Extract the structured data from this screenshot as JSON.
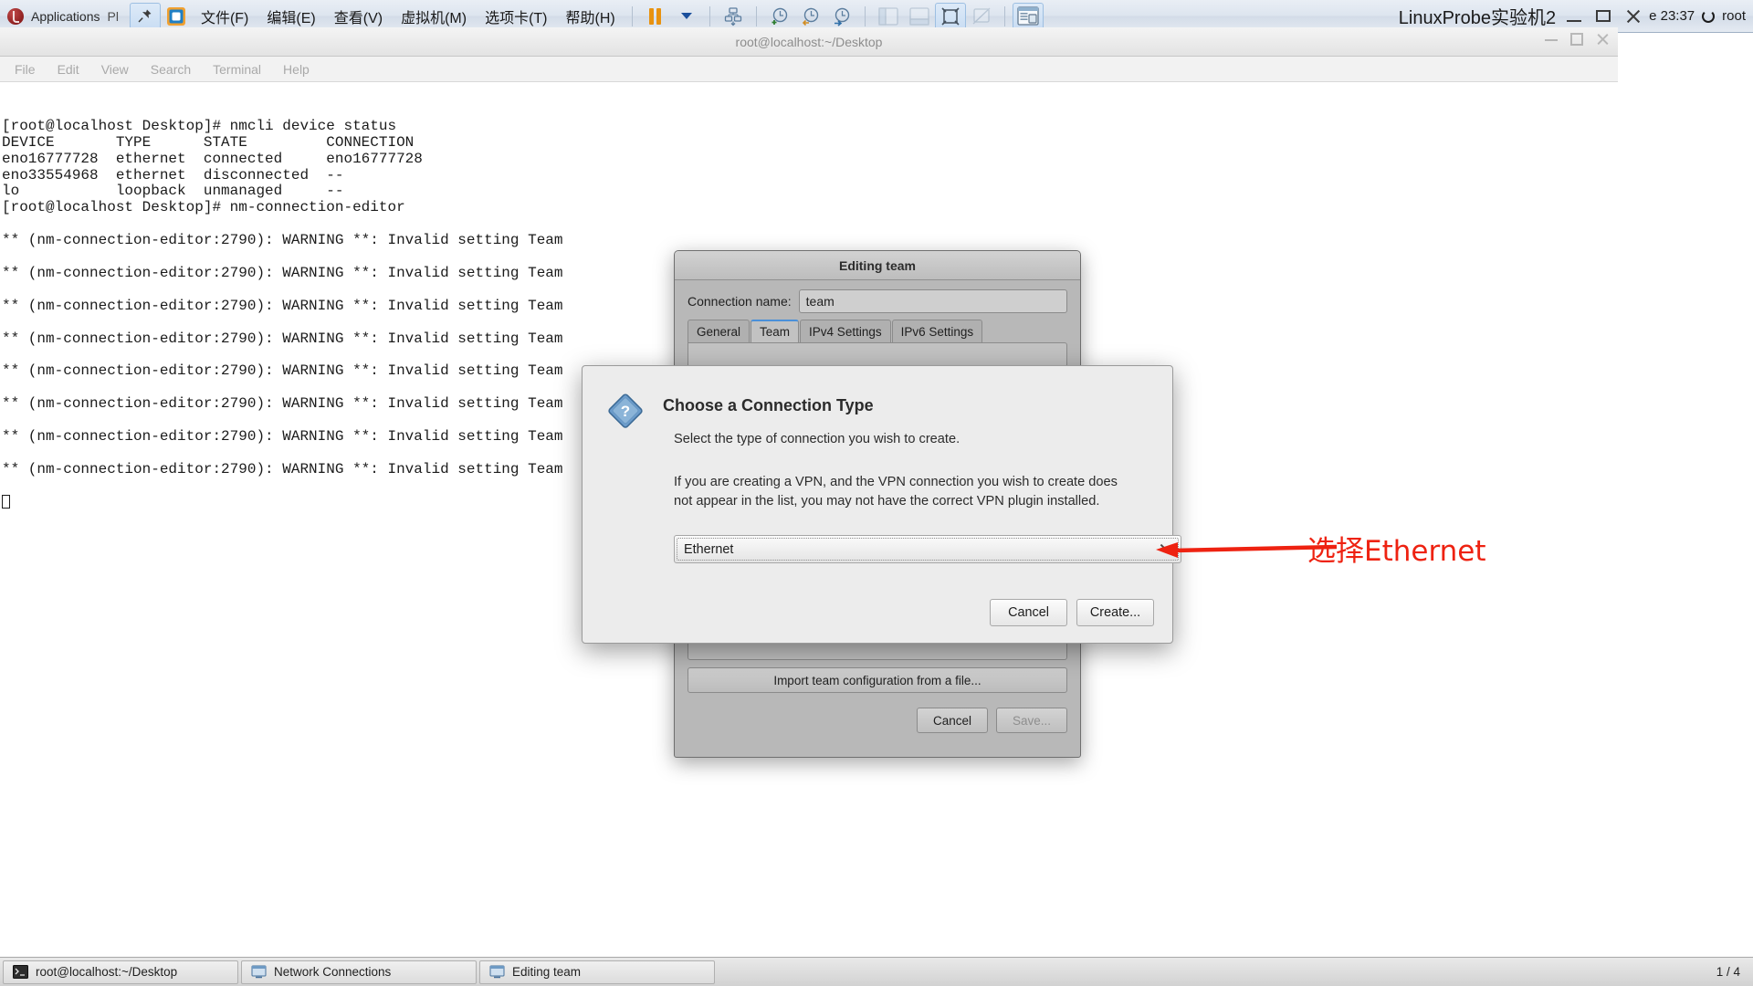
{
  "vmware": {
    "gnome_applications": "Applications",
    "gnome_places": "Pl",
    "menus": [
      "文件(F)",
      "编辑(E)",
      "查看(V)",
      "虚拟机(M)",
      "选项卡(T)",
      "帮助(H)"
    ],
    "vm_title": "LinuxProbe实验机2",
    "clock": "e 23:37",
    "user": "root",
    "icons": {
      "pin": "pin-icon",
      "vmware_logo": "vmware-logo-icon",
      "pause": "pause-icon",
      "dropdown": "caret-down-icon",
      "snapshot": "snapshot-manager-icon",
      "take_snapshot": "take-snapshot-icon",
      "revert_snapshot": "revert-snapshot-icon",
      "manage_snapshot": "manage-snapshot-icon",
      "show_library": "show-library-icon",
      "show_thumbnails": "show-thumbnail-bar-icon",
      "fullscreen": "enter-fullscreen-icon",
      "unity": "unity-mode-icon",
      "console_view": "console-view-icon",
      "minimize": "minimize-icon",
      "maximize": "maximize-icon",
      "close": "close-icon",
      "power": "power-icon"
    }
  },
  "terminal": {
    "title": "root@localhost:~/Desktop",
    "menus": [
      "File",
      "Edit",
      "View",
      "Search",
      "Terminal",
      "Help"
    ],
    "lines": [
      "[root@localhost Desktop]# nmcli device status",
      "DEVICE       TYPE      STATE         CONNECTION",
      "eno16777728  ethernet  connected     eno16777728",
      "eno33554968  ethernet  disconnected  --",
      "lo           loopback  unmanaged     --",
      "[root@localhost Desktop]# nm-connection-editor",
      "",
      "** (nm-connection-editor:2790): WARNING **: Invalid setting Team",
      "",
      "** (nm-connection-editor:2790): WARNING **: Invalid setting Team",
      "",
      "** (nm-connection-editor:2790): WARNING **: Invalid setting Team",
      "",
      "** (nm-connection-editor:2790): WARNING **: Invalid setting Team",
      "",
      "** (nm-connection-editor:2790): WARNING **: Invalid setting Team",
      "",
      "** (nm-connection-editor:2790): WARNING **: Invalid setting Team",
      "",
      "** (nm-connection-editor:2790): WARNING **: Invalid setting Team",
      "",
      "** (nm-connection-editor:2790): WARNING **: Invalid setting Team",
      ""
    ]
  },
  "editing_team": {
    "title": "Editing team",
    "connection_name_label": "Connection name:",
    "connection_name_value": "team",
    "tabs": [
      "General",
      "Team",
      "IPv4 Settings",
      "IPv6 Settings"
    ],
    "selected_tab": "Team",
    "import_button": "Import team configuration from a file...",
    "cancel_button": "Cancel",
    "save_button": "Save..."
  },
  "choose_connection_type": {
    "heading": "Choose a Connection Type",
    "paragraph_1": "Select the type of connection you wish to create.",
    "paragraph_2": "If you are creating a VPN, and the VPN connection you wish to create does not appear in the list, you may not have the correct VPN plugin installed.",
    "combo_value": "Ethernet",
    "cancel_button": "Cancel",
    "create_button": "Create...",
    "icon": "question-diamond-icon"
  },
  "annotation": {
    "text": "选择Ethernet",
    "color": "#ee2211",
    "arrow": "left-arrow-icon"
  },
  "taskbar": {
    "items": [
      {
        "label": "root@localhost:~/Desktop",
        "icon": "terminal-icon"
      },
      {
        "label": "Network Connections",
        "icon": "window-icon"
      },
      {
        "label": "Editing team",
        "icon": "window-icon"
      }
    ],
    "pager": "1 / 4"
  }
}
